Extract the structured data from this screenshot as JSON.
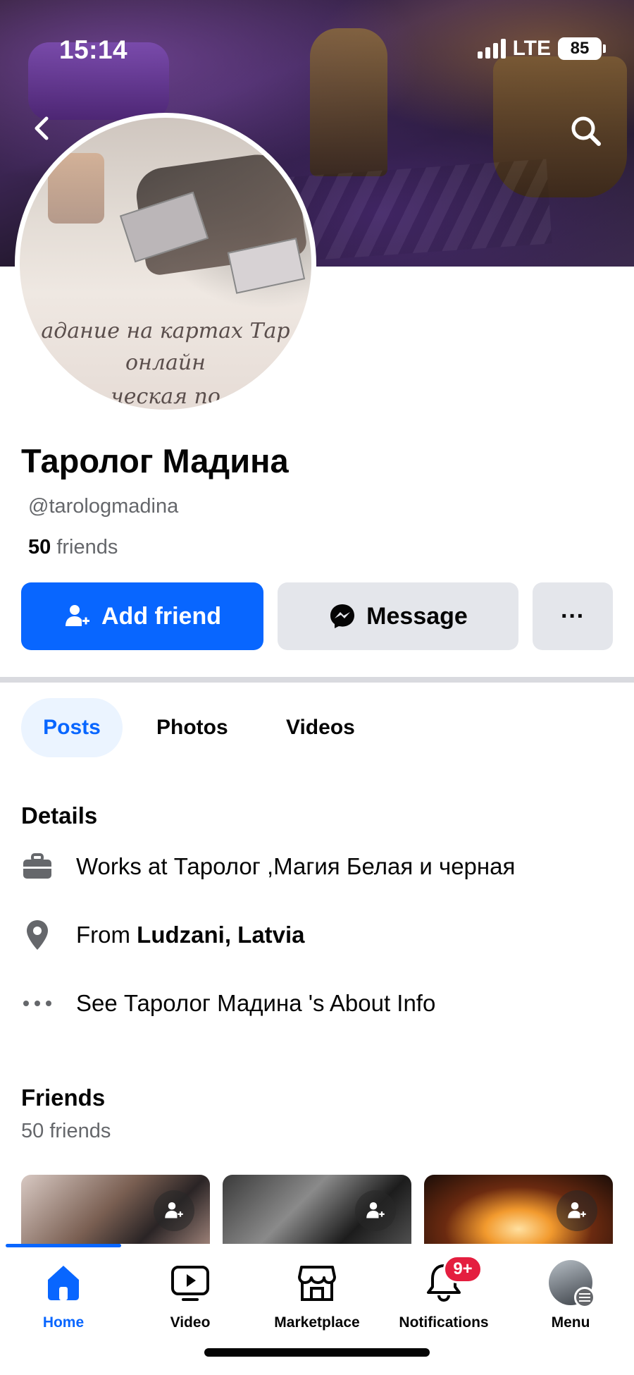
{
  "status_bar": {
    "time": "15:14",
    "network": "LTE",
    "battery": "85"
  },
  "profile": {
    "name": "Таролог Мадина",
    "username": "@tarologmadina",
    "friends_count": "50",
    "friends_label": "friends",
    "avatar_caption_line1": "адание на картах Тар",
    "avatar_caption_line2": "онлайн",
    "avatar_caption_line3": "ческая по"
  },
  "actions": {
    "add_friend": "Add friend",
    "message": "Message",
    "more": "···"
  },
  "tabs": [
    {
      "label": "Posts",
      "selected": true
    },
    {
      "label": "Photos",
      "selected": false
    },
    {
      "label": "Videos",
      "selected": false
    }
  ],
  "details": {
    "title": "Details",
    "work": "Works at Таролог ,Магия Белая и черная",
    "from_prefix": "From",
    "from_place": "Ludzani, Latvia",
    "about": "See Таролог Мадина 's About Info"
  },
  "friends_section": {
    "title": "Friends",
    "subtitle": "50 friends"
  },
  "bottom_nav": [
    {
      "label": "Home",
      "icon": "home-icon",
      "active": true
    },
    {
      "label": "Video",
      "icon": "video-icon",
      "active": false
    },
    {
      "label": "Marketplace",
      "icon": "marketplace-icon",
      "active": false
    },
    {
      "label": "Notifications",
      "icon": "bell-icon",
      "active": false,
      "badge": "9+"
    },
    {
      "label": "Menu",
      "icon": "menu-avatar",
      "active": false
    }
  ],
  "colors": {
    "accent": "#0866ff",
    "badge": "#e41e3f",
    "secondary_text": "#65676b",
    "button_gray": "#e4e6eb"
  }
}
